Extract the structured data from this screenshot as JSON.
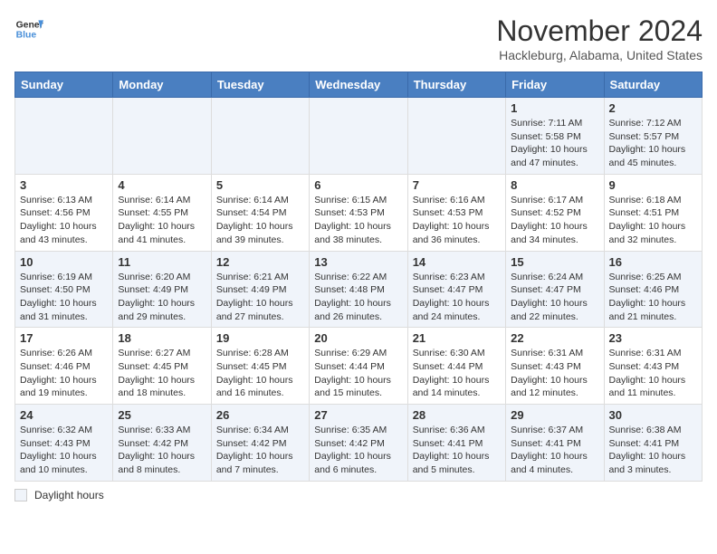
{
  "header": {
    "logo_line1": "General",
    "logo_line2": "Blue",
    "month": "November 2024",
    "location": "Hackleburg, Alabama, United States"
  },
  "days_of_week": [
    "Sunday",
    "Monday",
    "Tuesday",
    "Wednesday",
    "Thursday",
    "Friday",
    "Saturday"
  ],
  "weeks": [
    [
      {
        "day": "",
        "info": ""
      },
      {
        "day": "",
        "info": ""
      },
      {
        "day": "",
        "info": ""
      },
      {
        "day": "",
        "info": ""
      },
      {
        "day": "",
        "info": ""
      },
      {
        "day": "1",
        "info": "Sunrise: 7:11 AM\nSunset: 5:58 PM\nDaylight: 10 hours\nand 47 minutes."
      },
      {
        "day": "2",
        "info": "Sunrise: 7:12 AM\nSunset: 5:57 PM\nDaylight: 10 hours\nand 45 minutes."
      }
    ],
    [
      {
        "day": "3",
        "info": "Sunrise: 6:13 AM\nSunset: 4:56 PM\nDaylight: 10 hours\nand 43 minutes."
      },
      {
        "day": "4",
        "info": "Sunrise: 6:14 AM\nSunset: 4:55 PM\nDaylight: 10 hours\nand 41 minutes."
      },
      {
        "day": "5",
        "info": "Sunrise: 6:14 AM\nSunset: 4:54 PM\nDaylight: 10 hours\nand 39 minutes."
      },
      {
        "day": "6",
        "info": "Sunrise: 6:15 AM\nSunset: 4:53 PM\nDaylight: 10 hours\nand 38 minutes."
      },
      {
        "day": "7",
        "info": "Sunrise: 6:16 AM\nSunset: 4:53 PM\nDaylight: 10 hours\nand 36 minutes."
      },
      {
        "day": "8",
        "info": "Sunrise: 6:17 AM\nSunset: 4:52 PM\nDaylight: 10 hours\nand 34 minutes."
      },
      {
        "day": "9",
        "info": "Sunrise: 6:18 AM\nSunset: 4:51 PM\nDaylight: 10 hours\nand 32 minutes."
      }
    ],
    [
      {
        "day": "10",
        "info": "Sunrise: 6:19 AM\nSunset: 4:50 PM\nDaylight: 10 hours\nand 31 minutes."
      },
      {
        "day": "11",
        "info": "Sunrise: 6:20 AM\nSunset: 4:49 PM\nDaylight: 10 hours\nand 29 minutes."
      },
      {
        "day": "12",
        "info": "Sunrise: 6:21 AM\nSunset: 4:49 PM\nDaylight: 10 hours\nand 27 minutes."
      },
      {
        "day": "13",
        "info": "Sunrise: 6:22 AM\nSunset: 4:48 PM\nDaylight: 10 hours\nand 26 minutes."
      },
      {
        "day": "14",
        "info": "Sunrise: 6:23 AM\nSunset: 4:47 PM\nDaylight: 10 hours\nand 24 minutes."
      },
      {
        "day": "15",
        "info": "Sunrise: 6:24 AM\nSunset: 4:47 PM\nDaylight: 10 hours\nand 22 minutes."
      },
      {
        "day": "16",
        "info": "Sunrise: 6:25 AM\nSunset: 4:46 PM\nDaylight: 10 hours\nand 21 minutes."
      }
    ],
    [
      {
        "day": "17",
        "info": "Sunrise: 6:26 AM\nSunset: 4:46 PM\nDaylight: 10 hours\nand 19 minutes."
      },
      {
        "day": "18",
        "info": "Sunrise: 6:27 AM\nSunset: 4:45 PM\nDaylight: 10 hours\nand 18 minutes."
      },
      {
        "day": "19",
        "info": "Sunrise: 6:28 AM\nSunset: 4:45 PM\nDaylight: 10 hours\nand 16 minutes."
      },
      {
        "day": "20",
        "info": "Sunrise: 6:29 AM\nSunset: 4:44 PM\nDaylight: 10 hours\nand 15 minutes."
      },
      {
        "day": "21",
        "info": "Sunrise: 6:30 AM\nSunset: 4:44 PM\nDaylight: 10 hours\nand 14 minutes."
      },
      {
        "day": "22",
        "info": "Sunrise: 6:31 AM\nSunset: 4:43 PM\nDaylight: 10 hours\nand 12 minutes."
      },
      {
        "day": "23",
        "info": "Sunrise: 6:31 AM\nSunset: 4:43 PM\nDaylight: 10 hours\nand 11 minutes."
      }
    ],
    [
      {
        "day": "24",
        "info": "Sunrise: 6:32 AM\nSunset: 4:43 PM\nDaylight: 10 hours\nand 10 minutes."
      },
      {
        "day": "25",
        "info": "Sunrise: 6:33 AM\nSunset: 4:42 PM\nDaylight: 10 hours\nand 8 minutes."
      },
      {
        "day": "26",
        "info": "Sunrise: 6:34 AM\nSunset: 4:42 PM\nDaylight: 10 hours\nand 7 minutes."
      },
      {
        "day": "27",
        "info": "Sunrise: 6:35 AM\nSunset: 4:42 PM\nDaylight: 10 hours\nand 6 minutes."
      },
      {
        "day": "28",
        "info": "Sunrise: 6:36 AM\nSunset: 4:41 PM\nDaylight: 10 hours\nand 5 minutes."
      },
      {
        "day": "29",
        "info": "Sunrise: 6:37 AM\nSunset: 4:41 PM\nDaylight: 10 hours\nand 4 minutes."
      },
      {
        "day": "30",
        "info": "Sunrise: 6:38 AM\nSunset: 4:41 PM\nDaylight: 10 hours\nand 3 minutes."
      }
    ]
  ],
  "footer": {
    "daylight_label": "Daylight hours"
  }
}
